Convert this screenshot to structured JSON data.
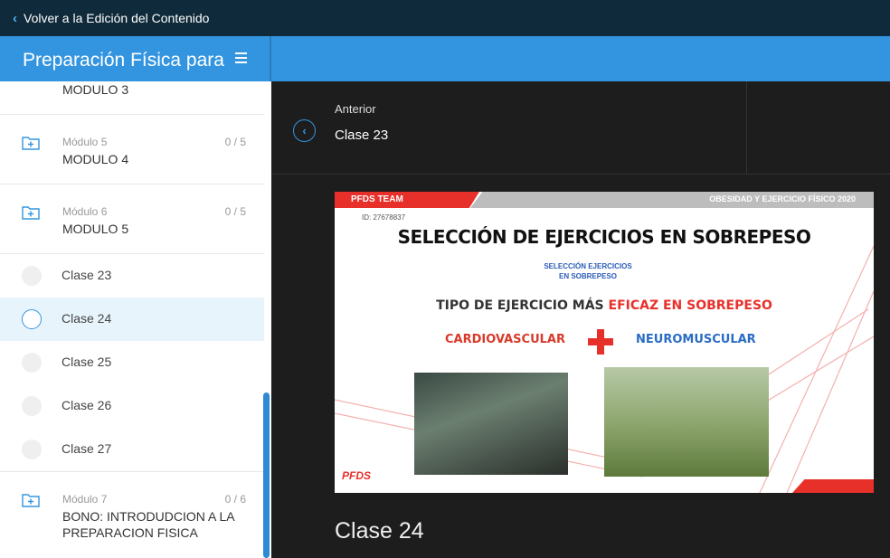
{
  "topbar": {
    "back_label": "Volver a la Edición del Contenido"
  },
  "course": {
    "title": "Preparación Física para"
  },
  "sidebar": {
    "modules": [
      {
        "title": "MODULO 3"
      },
      {
        "label": "Módulo 5",
        "count": "0 / 5",
        "title": "MODULO 4"
      },
      {
        "label": "Módulo 6",
        "count": "0 / 5",
        "title": "MODULO 5"
      },
      {
        "label": "Módulo 7",
        "count": "0 / 6",
        "title": "BONO: INTRODUDCION A LA PREPARACION FISICA"
      }
    ],
    "lessons": [
      {
        "title": "Clase 23",
        "active": false
      },
      {
        "title": "Clase 24",
        "active": true
      },
      {
        "title": "Clase 25",
        "active": false
      },
      {
        "title": "Clase 26",
        "active": false
      },
      {
        "title": "Clase 27",
        "active": false
      }
    ]
  },
  "nav": {
    "prev_label": "Anterior",
    "prev_title": "Clase 23"
  },
  "slide": {
    "team": "PFDS TEAM",
    "course": "OBESIDAD Y EJERCICIO FÍSICO 2020",
    "id": "ID: 27678837",
    "title": "SELECCIÓN DE EJERCICIOS EN SOBREPESO",
    "subtitle_1": "SELECCIÓN EJERCICIOS",
    "subtitle_2": "EN SOBREPESO",
    "type_prefix": "TIPO DE EJERCICIO MÁS",
    "type_highlight": "EFICAZ EN SOBREPESO",
    "cardio": "CARDIOVASCULAR",
    "neuro": "NEUROMUSCULAR",
    "logo": "PFDS"
  },
  "lesson": {
    "title": "Clase 24"
  },
  "colors": {
    "accent": "#3395e0",
    "topbar": "#0f2a3a",
    "main_bg": "#1d1d1d",
    "red": "#e8302b"
  }
}
